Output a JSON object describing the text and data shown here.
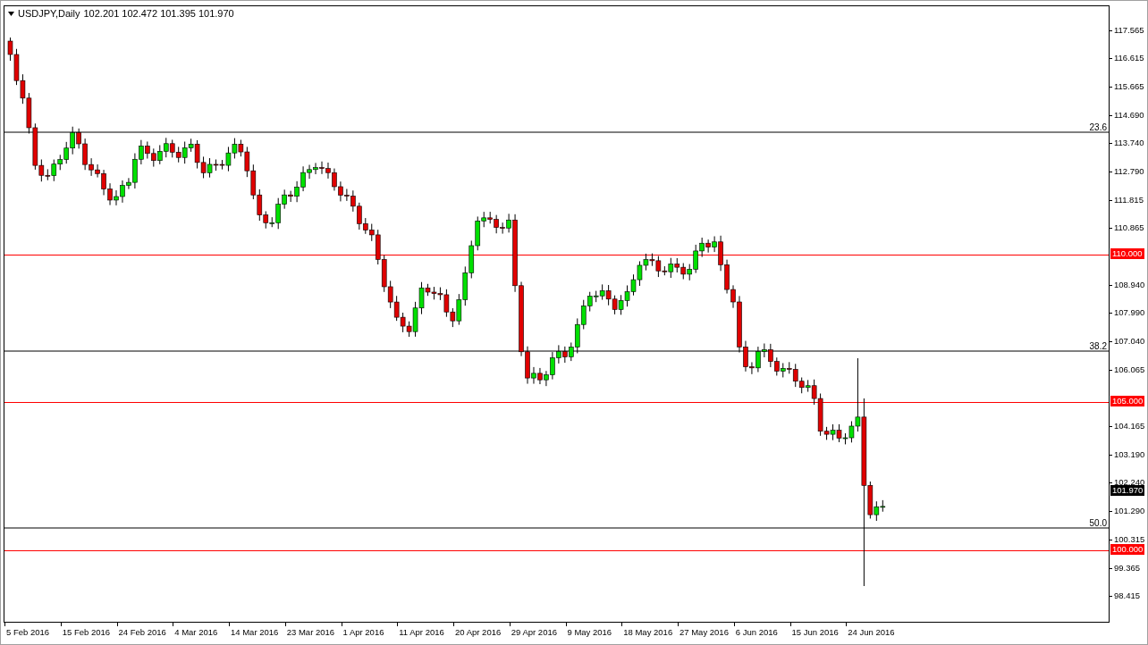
{
  "header": {
    "symbol": "USDJPY,Daily",
    "ohlc": "102.201 102.472 101.395 101.970"
  },
  "price_axis": {
    "ticks": [
      "117.565",
      "116.615",
      "115.665",
      "114.690",
      "113.740",
      "112.790",
      "111.815",
      "110.865",
      "108.940",
      "107.990",
      "107.040",
      "106.065",
      "104.165",
      "103.190",
      "102.240",
      "101.290",
      "100.315",
      "99.365",
      "98.415"
    ]
  },
  "fibo_levels": [
    {
      "label": "23.6"
    },
    {
      "label": "38.2"
    },
    {
      "label": "50.0"
    }
  ],
  "price_lines": [
    {
      "label": "110.000",
      "color": "#ff0000"
    },
    {
      "label": "105.000",
      "color": "#ff0000"
    },
    {
      "label": "100.000",
      "color": "#ff0000"
    }
  ],
  "current_price": {
    "label": "101.970"
  },
  "time_axis": {
    "ticks": [
      "5 Feb 2016",
      "15 Feb 2016",
      "24 Feb 2016",
      "4 Mar 2016",
      "14 Mar 2016",
      "23 Mar 2016",
      "1 Apr 2016",
      "11 Apr 2016",
      "20 Apr 2016",
      "29 Apr 2016",
      "9 May 2016",
      "18 May 2016",
      "27 May 2016",
      "6 Jun 2016",
      "15 Jun 2016",
      "24 Jun 2016"
    ]
  }
}
